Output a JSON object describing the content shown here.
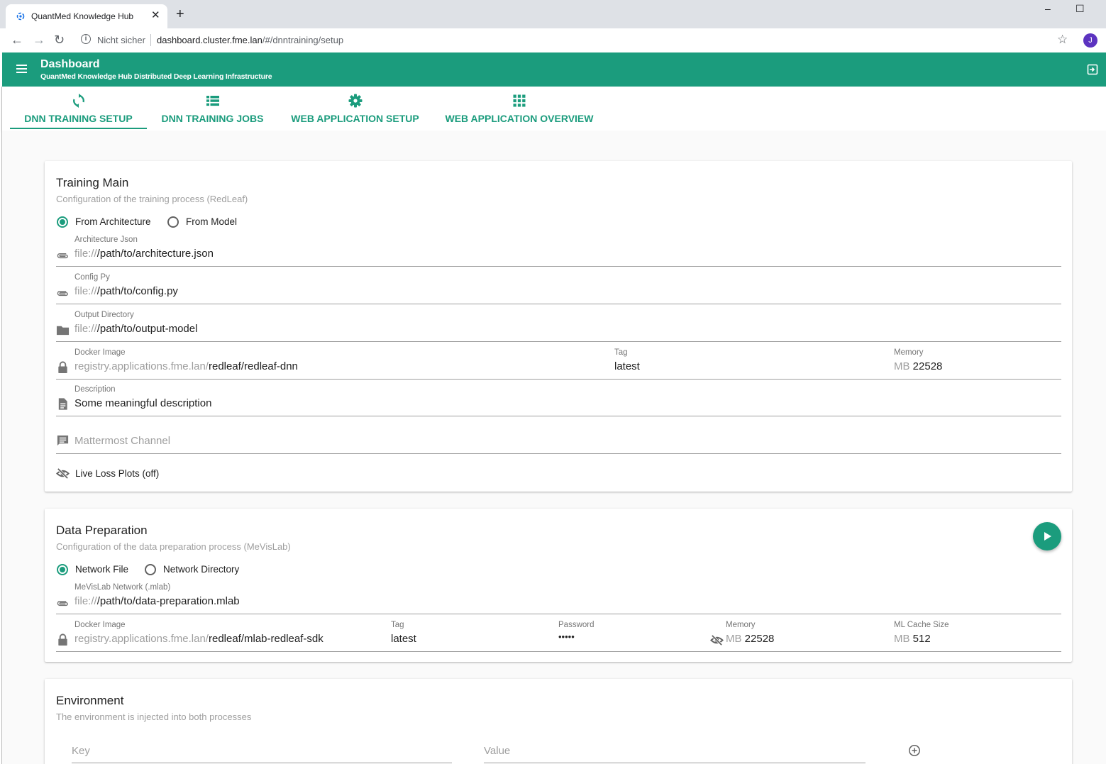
{
  "browser": {
    "tab_title": "QuantMed Knowledge Hub",
    "tab_close": "✕",
    "new_tab": "+",
    "minimize": "–",
    "maximize": "☐",
    "insecure_label": "Nicht sicher",
    "url_host": "dashboard.cluster.fme.lan",
    "url_path": "/#/dnntraining/setup",
    "profile_initial": "J"
  },
  "header": {
    "title": "Dashboard",
    "subtitle": "QuantMed Knowledge Hub Distributed Deep Learning Infrastructure"
  },
  "tabs": [
    {
      "label": "DNN TRAINING SETUP",
      "icon": "refresh-icon",
      "active": true
    },
    {
      "label": "DNN TRAINING JOBS",
      "icon": "list-icon",
      "active": false
    },
    {
      "label": "WEB APPLICATION SETUP",
      "icon": "gear-icon",
      "active": false
    },
    {
      "label": "WEB APPLICATION OVERVIEW",
      "icon": "apps-grid-icon",
      "active": false
    }
  ],
  "training": {
    "title": "Training Main",
    "subtitle": "Configuration of the training process (RedLeaf)",
    "radio_a": "From Architecture",
    "radio_b": "From Model",
    "selected": "From Architecture",
    "arch_label": "Architecture Json",
    "arch_prefix": "file://",
    "arch_value": "/path/to/architecture.json",
    "config_label": "Config Py",
    "config_prefix": "file://",
    "config_value": "/path/to/config.py",
    "output_label": "Output Directory",
    "output_prefix": "file://",
    "output_value": "/path/to/output-model",
    "docker_label": "Docker Image",
    "docker_prefix": "registry.applications.fme.lan/",
    "docker_value": "redleaf/redleaf-dnn",
    "tag_label": "Tag",
    "tag_value": "latest",
    "memory_label": "Memory",
    "memory_unit": "MB",
    "memory_value": "22528",
    "desc_label": "Description",
    "desc_value": "Some meaningful description",
    "mattermost_placeholder": "Mattermost Channel",
    "live_loss": "Live Loss Plots (off)"
  },
  "dataprep": {
    "title": "Data Preparation",
    "subtitle": "Configuration of the data preparation process (MeVisLab)",
    "radio_a": "Network File",
    "radio_b": "Network Directory",
    "selected": "Network File",
    "network_label": "MeVisLab Network (.mlab)",
    "network_prefix": "file://",
    "network_value": "/path/to/data-preparation.mlab",
    "docker_label": "Docker Image",
    "docker_prefix": "registry.applications.fme.lan/",
    "docker_value": "redleaf/mlab-redleaf-sdk",
    "tag_label": "Tag",
    "tag_value": "latest",
    "password_label": "Password",
    "password_value": "•••••",
    "memory_label": "Memory",
    "memory_unit": "MB",
    "memory_value": "22528",
    "cache_label": "ML Cache Size",
    "cache_unit": "MB",
    "cache_value": "512"
  },
  "environment": {
    "title": "Environment",
    "subtitle": "The environment is injected into both processes",
    "key_placeholder": "Key",
    "value_placeholder": "Value"
  },
  "colors": {
    "primary": "#1b9c7d",
    "text": "#212121",
    "muted": "#9e9e9e"
  }
}
